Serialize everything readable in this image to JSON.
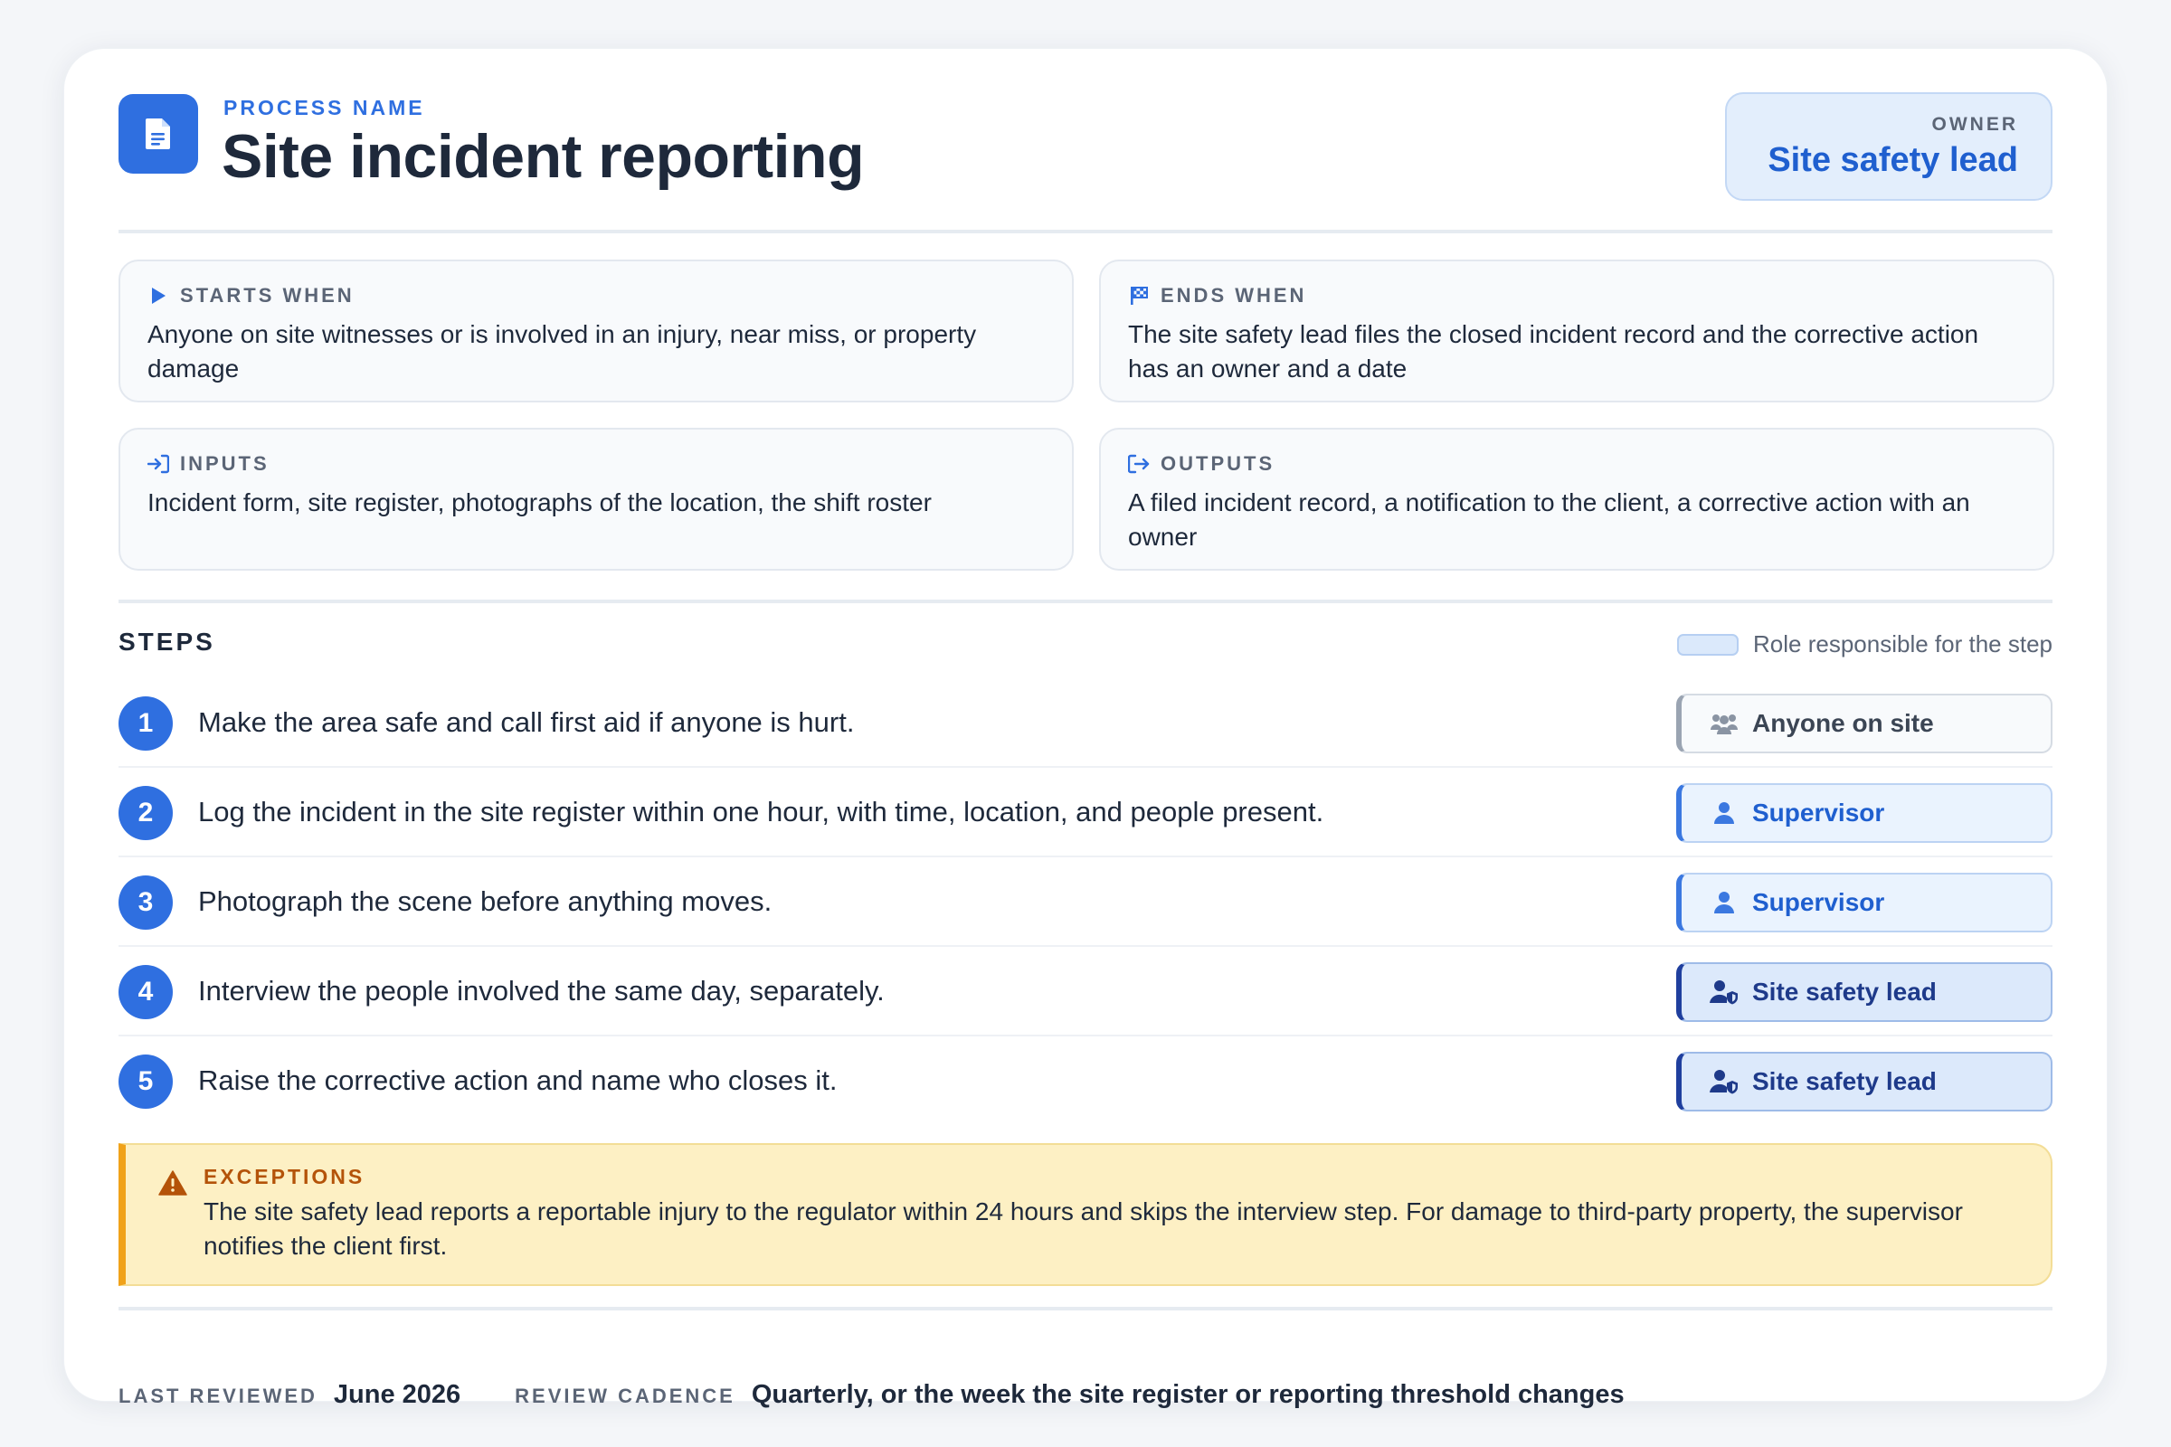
{
  "header": {
    "process_label": "PROCESS NAME",
    "title": "Site incident reporting",
    "owner_label": "OWNER",
    "owner_value": "Site safety lead"
  },
  "info": {
    "starts": {
      "label": "STARTS WHEN",
      "icon": "play-icon",
      "text": "Anyone on site witnesses or is involved in an injury, near miss, or property damage"
    },
    "ends": {
      "label": "ENDS WHEN",
      "icon": "flag-icon",
      "text": "The site safety lead files the closed incident record and the corrective action has an owner and a date"
    },
    "inputs": {
      "label": "INPUTS",
      "icon": "sign-in-icon",
      "text": "Incident form, site register, photographs of the location, the shift roster"
    },
    "outputs": {
      "label": "OUTPUTS",
      "icon": "sign-out-icon",
      "text": "A filed incident record, a notification to the client, a corrective action with an owner"
    }
  },
  "steps": {
    "title": "STEPS",
    "legend": "Role responsible for the step",
    "items": [
      {
        "num": "1",
        "text": "Make the area safe and call first aid if anyone is hurt.",
        "role": "Anyone on site",
        "role_icon": "people-icon"
      },
      {
        "num": "2",
        "text": "Log the incident in the site register within one hour, with time, location, and people present.",
        "role": "Supervisor",
        "role_icon": "user-icon"
      },
      {
        "num": "3",
        "text": "Photograph the scene before anything moves.",
        "role": "Supervisor",
        "role_icon": "user-icon"
      },
      {
        "num": "4",
        "text": "Interview the people involved the same day, separately.",
        "role": "Site safety lead",
        "role_icon": "user-shield-icon"
      },
      {
        "num": "5",
        "text": "Raise the corrective action and name who closes it.",
        "role": "Site safety lead",
        "role_icon": "user-shield-icon"
      }
    ]
  },
  "exceptions": {
    "label": "EXCEPTIONS",
    "text": "The site safety lead reports a reportable injury to the regulator within 24 hours and skips the interview step. For damage to third-party property, the supervisor notifies the client first."
  },
  "footer": {
    "last_reviewed_label": "LAST REVIEWED",
    "last_reviewed_value": "June 2026",
    "cadence_label": "REVIEW CADENCE",
    "cadence_value": "Quarterly, or the week the site register or reporting threshold changes"
  },
  "colors": {
    "accent": "#2f6fe0",
    "warning": "#f0a21a",
    "role_dark": "#1e3a8a"
  }
}
